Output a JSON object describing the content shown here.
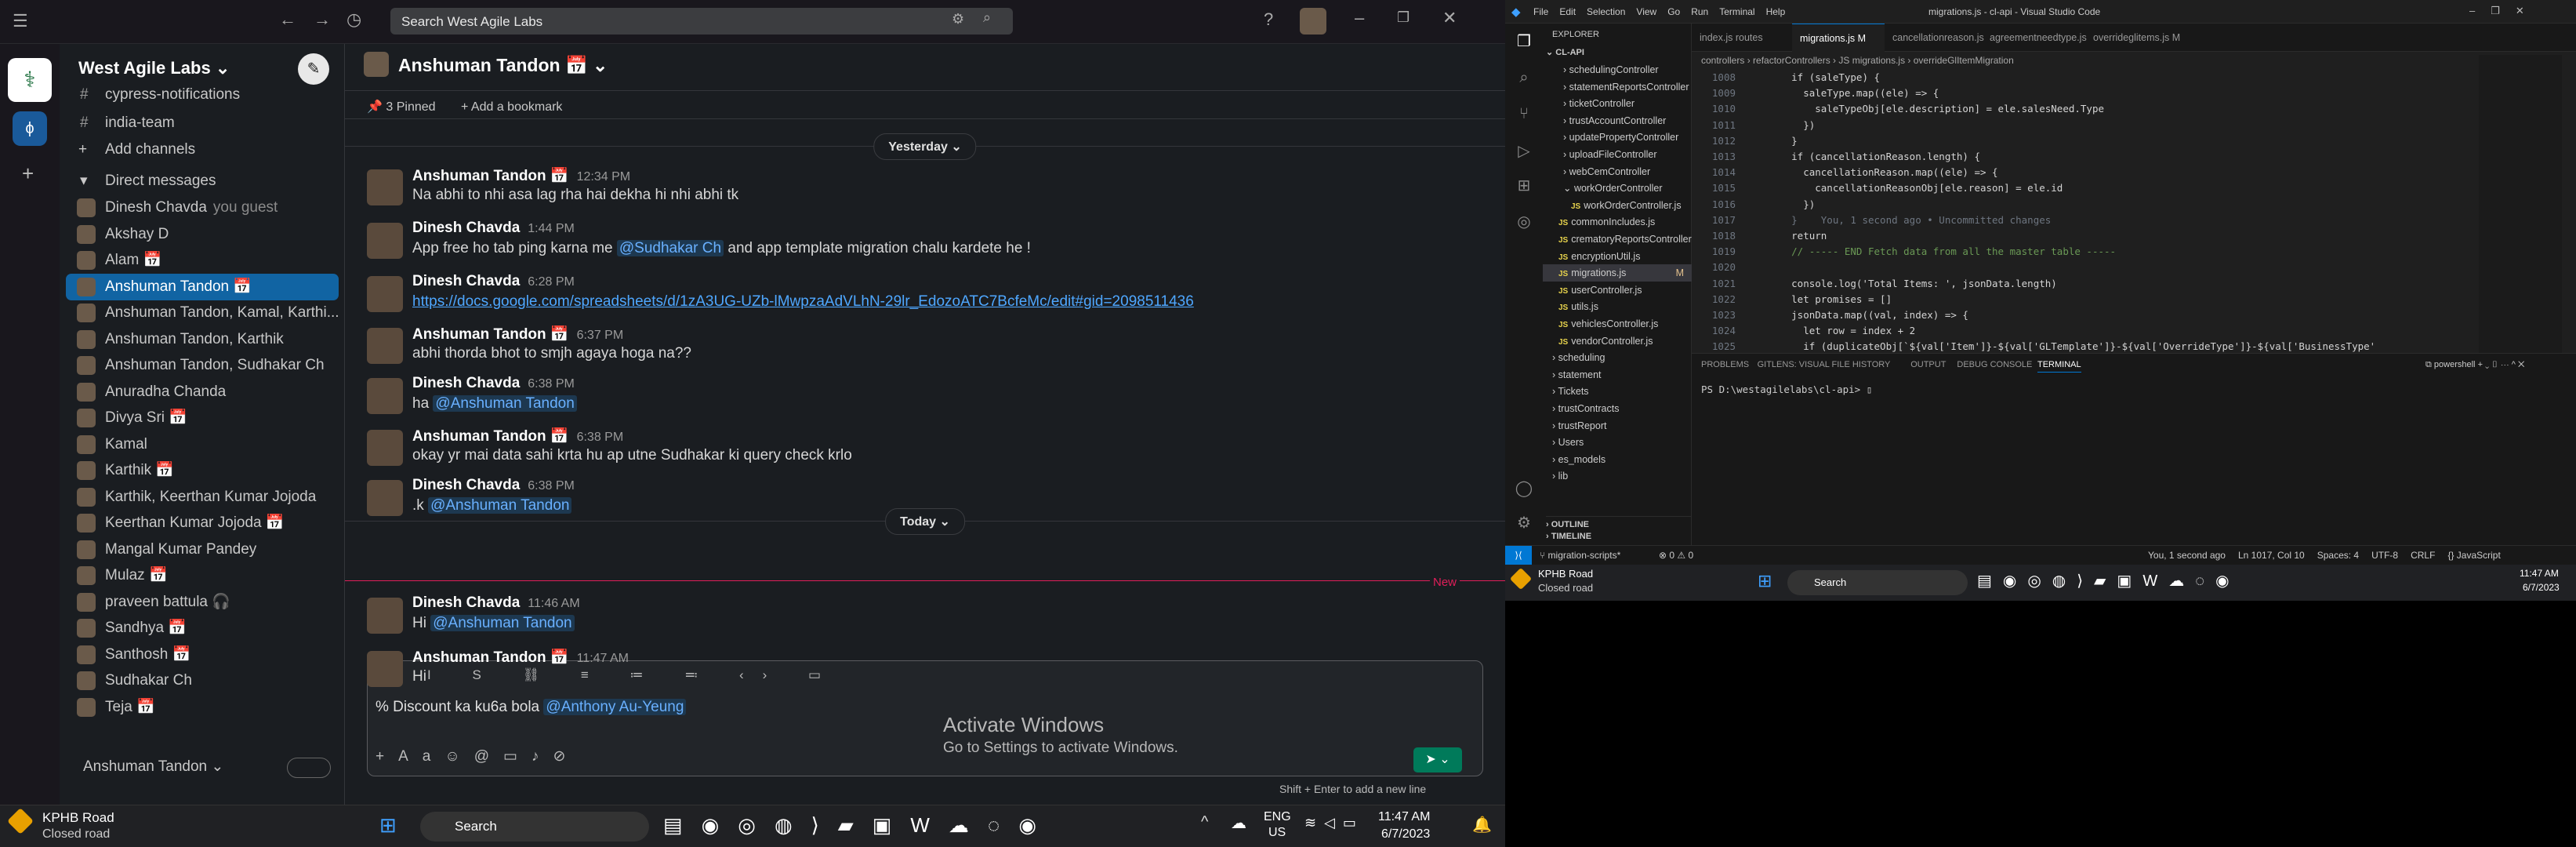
{
  "slack": {
    "search_placeholder": "Search West Agile Labs",
    "workspace": "West Agile Labs",
    "sidebar_top": [
      "cypress-notifications",
      "india-team"
    ],
    "add_channels": "Add channels",
    "dm_header": "Direct messages",
    "dms": [
      {
        "name": "Dinesh Chavda",
        "suffix": "you  guest"
      },
      {
        "name": "Akshay D",
        "suffix": ""
      },
      {
        "name": "Alam 📅",
        "suffix": ""
      },
      {
        "name": "Anshuman Tandon 📅",
        "suffix": ""
      },
      {
        "name": "Anshuman Tandon, Kamal, Karthi...",
        "suffix": ""
      },
      {
        "name": "Anshuman Tandon, Karthik",
        "suffix": ""
      },
      {
        "name": "Anshuman Tandon, Sudhakar Ch",
        "suffix": ""
      },
      {
        "name": "Anuradha Chanda",
        "suffix": ""
      },
      {
        "name": "Divya Sri 📅",
        "suffix": ""
      },
      {
        "name": "Kamal",
        "suffix": ""
      },
      {
        "name": "Karthik 📅",
        "suffix": ""
      },
      {
        "name": "Karthik, Keerthan Kumar Jojoda",
        "suffix": ""
      },
      {
        "name": "Keerthan Kumar Jojoda 📅",
        "suffix": ""
      },
      {
        "name": "Mangal Kumar Pandey",
        "suffix": ""
      },
      {
        "name": "Mulaz 📅",
        "suffix": ""
      },
      {
        "name": "praveen battula 🎧",
        "suffix": ""
      },
      {
        "name": "Sandhya 📅",
        "suffix": ""
      },
      {
        "name": "Santhosh 📅",
        "suffix": ""
      },
      {
        "name": "Sudhakar Ch",
        "suffix": ""
      },
      {
        "name": "Teja 📅",
        "suffix": ""
      }
    ],
    "footer_user": "Anshuman Tandon",
    "channel_title": "Anshuman Tandon 📅",
    "pinned": "3 Pinned",
    "bookmark": "Add a bookmark",
    "day_yesterday": "Yesterday",
    "day_today": "Today",
    "new_label": "New",
    "messages": [
      {
        "name": "Anshuman Tandon 📅",
        "time": "12:34 PM",
        "text": "Na abhi to nhi asa lag rha hai dekha hi nhi abhi tk"
      },
      {
        "name": "Dinesh Chavda",
        "time": "1:44 PM",
        "pre": "App free ho tab ping karna me ",
        "mention": "@Sudhakar Ch",
        "post": " and app template migration chalu kardete he !"
      },
      {
        "name": "Dinesh Chavda",
        "time": "6:28 PM",
        "link": "https://docs.google.com/spreadsheets/d/1zA3UG-UZb-lMwpzaAdVLhN-29lr_EdozoATC7BcfeMc/edit#gid=2098511436"
      },
      {
        "name": "Anshuman Tandon 📅",
        "time": "6:37 PM",
        "text": "abhi thorda bhot to smjh agaya hoga na??"
      },
      {
        "name": "Dinesh Chavda",
        "time": "6:38 PM",
        "pre": "ha ",
        "mention": "@Anshuman Tandon",
        "post": ""
      },
      {
        "name": "Anshuman Tandon 📅",
        "time": "6:38 PM",
        "text": "okay yr mai data sahi krta hu ap utne Sudhakar ki query check krlo"
      },
      {
        "name": "Dinesh Chavda",
        "time": "6:38 PM",
        "pre": ".k ",
        "mention": "@Anshuman Tandon",
        "post": ""
      },
      {
        "name": "Dinesh Chavda",
        "time": "11:46 AM",
        "pre": "Hi ",
        "mention": "@Anshuman Tandon",
        "post": ""
      },
      {
        "name": "Anshuman Tandon 📅",
        "time": "11:47 AM",
        "text": "Hi"
      }
    ],
    "composer_text": "% Discount ka ku6a bola ",
    "composer_mention": "@Anthony Au-Yeung",
    "activate_title": "Activate Windows",
    "activate_sub": "Go to Settings to activate Windows.",
    "hint": "Shift + Enter to add a new line"
  },
  "taskbar_left": {
    "weather_title": "KPHB Road",
    "weather_sub": "Closed road",
    "search": "Search",
    "lang1": "ENG",
    "lang2": "US",
    "time": "11:47 AM",
    "date": "6/7/2023"
  },
  "vscode": {
    "menu": [
      "File",
      "Edit",
      "Selection",
      "View",
      "Go",
      "Run",
      "Terminal",
      "Help"
    ],
    "title": "migrations.js - cl-api - Visual Studio Code",
    "explorer_label": "EXPLORER",
    "root": "CL-API",
    "tree": [
      "schedulingController",
      "statementReportsController",
      "ticketController",
      "trustAccountController",
      "updatePropertyController",
      "uploadFileController",
      "webCemController",
      "workOrderController",
      "workOrderController.js",
      "commonIncludes.js",
      "crematoryReportsController.js",
      "encryptionUtil.js",
      "migrations.js",
      "userController.js",
      "utils.js",
      "vehiclesController.js",
      "vendorController.js",
      "scheduling",
      "statement",
      "Tickets",
      "trustContracts",
      "trustReport",
      "Users",
      "es_models",
      "lib"
    ],
    "outline": "OUTLINE",
    "timeline": "TIMELINE",
    "tabs": [
      "index.js routes",
      "migrations.js M",
      "cancellationreason.js",
      "agreementneedtype.js",
      "overrideglitems.js M"
    ],
    "breadcrumb": "controllers › refactorControllers › JS migrations.js › overrideGlItemMigration",
    "code": [
      [
        "1008",
        "      if (saleType) {"
      ],
      [
        "1009",
        "        saleType.map((ele) => {"
      ],
      [
        "1010",
        "          saleTypeObj[ele.description] = ele.salesNeed.Type"
      ],
      [
        "1011",
        "        })"
      ],
      [
        "1012",
        "      }"
      ],
      [
        "1013",
        "      if (cancellationReason.length) {"
      ],
      [
        "1014",
        "        cancellationReason.map((ele) => {"
      ],
      [
        "1015",
        "          cancellationReasonObj[ele.reason] = ele.id"
      ],
      [
        "1016",
        "        })"
      ],
      [
        "1017",
        "      }    You, 1 second ago • Uncommitted changes"
      ],
      [
        "1018",
        "      return"
      ],
      [
        "1019",
        "      // ----- END Fetch data from all the master table -----"
      ],
      [
        "1020",
        ""
      ],
      [
        "1021",
        "      console.log('Total Items: ', jsonData.length)"
      ],
      [
        "1022",
        "      let promises = []"
      ],
      [
        "1023",
        "      jsonData.map((val, index) => {"
      ],
      [
        "1024",
        "        let row = index + 2"
      ],
      [
        "1025",
        "        if (duplicateObj[`${val['Item']}-${val['GLTemplate']}-${val['OverrideType']}-${val['BusinessType'"
      ]
    ],
    "panel_tabs": [
      "PROBLEMS",
      "GITLENS: VISUAL FILE HISTORY",
      "OUTPUT",
      "DEBUG CONSOLE",
      "TERMINAL"
    ],
    "shell": "powershell",
    "prompt": "PS D:\\westagilelabs\\cl-api> ",
    "status_left": "migration-scripts*",
    "status_errs": "⊗ 0 ⚠ 0",
    "status_right": [
      "You, 1 second ago",
      "Ln 1017, Col 10",
      "Spaces: 4",
      "UTF-8",
      "CRLF",
      "{} JavaScript"
    ]
  },
  "taskbar_right": {
    "weather_title": "KPHB Road",
    "weather_sub": "Closed road",
    "search": "Search",
    "time": "11:47 AM",
    "date": "6/7/2023"
  }
}
